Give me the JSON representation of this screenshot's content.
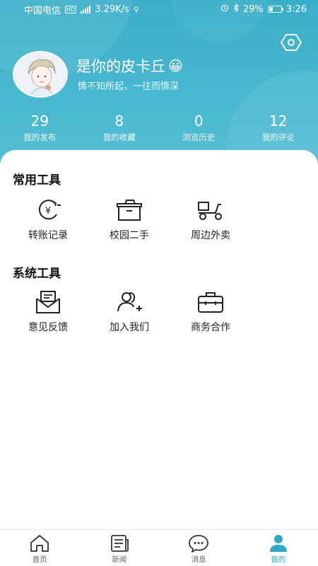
{
  "status_bar": {
    "carrier": "中国电信",
    "network_badge": "HD",
    "speed": "3.29K/s",
    "battery": "29%",
    "time": "3:26"
  },
  "profile": {
    "username": "是你的皮卡丘",
    "emoji": "😀",
    "bio": "情不知所起，一往而情深",
    "avatar_icon": "avatar-icon"
  },
  "stats": [
    {
      "value": "29",
      "label": "我的发布"
    },
    {
      "value": "8",
      "label": "我的收藏"
    },
    {
      "value": "0",
      "label": "浏览历史"
    },
    {
      "value": "12",
      "label": "我的评论"
    }
  ],
  "common_tools": {
    "title": "常用工具",
    "items": [
      {
        "label": "转账记录",
        "icon": "transfer-record-icon"
      },
      {
        "label": "校园二手",
        "icon": "secondhand-box-icon"
      },
      {
        "label": "周边外卖",
        "icon": "delivery-scooter-icon"
      }
    ]
  },
  "system_tools": {
    "title": "系统工具",
    "items": [
      {
        "label": "意见反馈",
        "icon": "feedback-mail-icon"
      },
      {
        "label": "加入我们",
        "icon": "add-user-icon"
      },
      {
        "label": "商务合作",
        "icon": "briefcase-icon"
      }
    ]
  },
  "tabbar": [
    {
      "label": "首页",
      "icon": "home-icon"
    },
    {
      "label": "新闻",
      "icon": "news-icon"
    },
    {
      "label": "消息",
      "icon": "message-icon"
    },
    {
      "label": "我的",
      "icon": "profile-icon",
      "active": true
    }
  ],
  "colors": {
    "header": "#3aaec9",
    "accent": "#2fa8c6"
  }
}
